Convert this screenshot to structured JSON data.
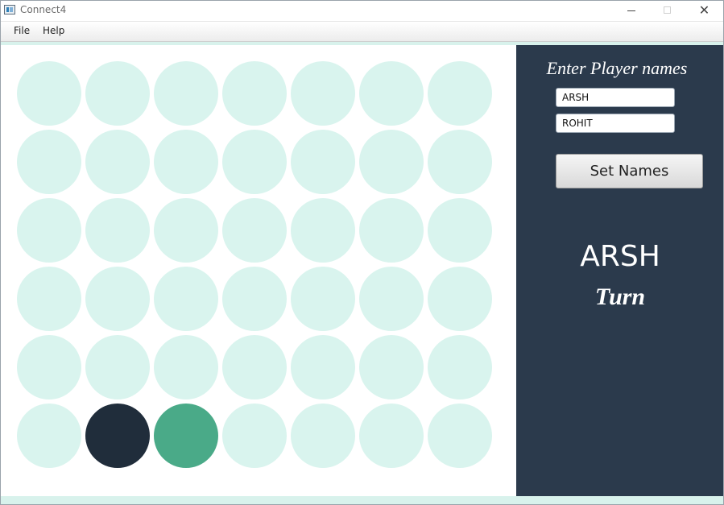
{
  "window": {
    "title": "Connect4"
  },
  "menu": {
    "file_label": "File",
    "help_label": "Help"
  },
  "board": {
    "rows": 6,
    "columns": 7,
    "empty_color": "#d9f4ee",
    "player1_color": "#202d3b",
    "player2_color": "#4aaa88",
    "discs": [
      {
        "row": 6,
        "column": 2,
        "player": 1
      },
      {
        "row": 6,
        "column": 3,
        "player": 2
      }
    ]
  },
  "panel": {
    "title": "Enter Player names",
    "player1_value": "ARSH",
    "player2_value": "ROHIT",
    "set_button_label": "Set Names",
    "current_player": "ARSH",
    "turn_label": "Turn",
    "background_color": "#2b3a4c"
  }
}
